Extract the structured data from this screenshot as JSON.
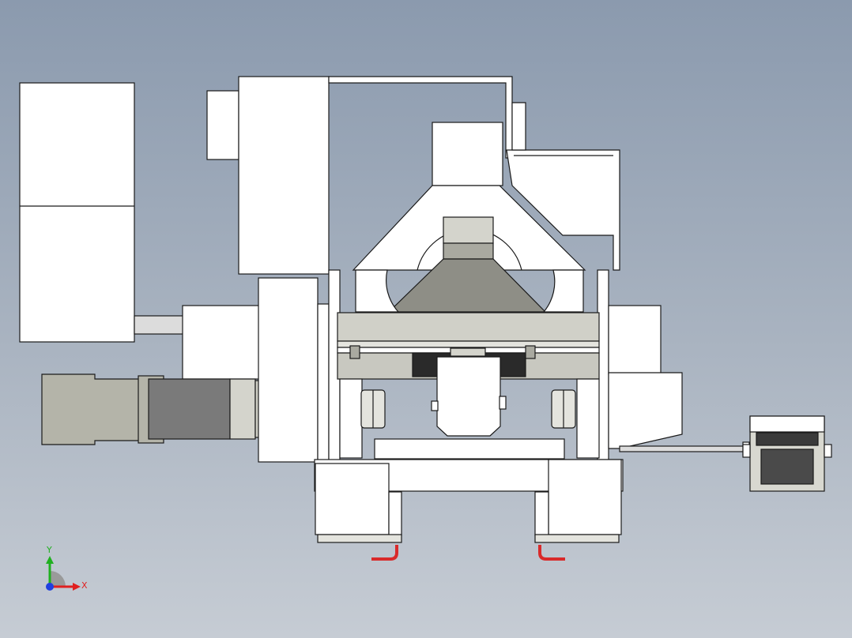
{
  "viewport": {
    "background_top": "#8b9aae",
    "background_bottom": "#c6ccd4"
  },
  "colors": {
    "part_fill": "#ffffff",
    "edge": "#1a1a1a",
    "motor_light": "#b4b4a9",
    "motor_dark": "#7a7a7a",
    "cone": "#8e8e86",
    "rail": "#c8c8c0",
    "hose": "#d92a2a",
    "axis_x": "#e02020",
    "axis_y": "#20b020",
    "axis_z": "#2040e0"
  },
  "triad": {
    "x_label": "X",
    "y_label": "Y"
  }
}
